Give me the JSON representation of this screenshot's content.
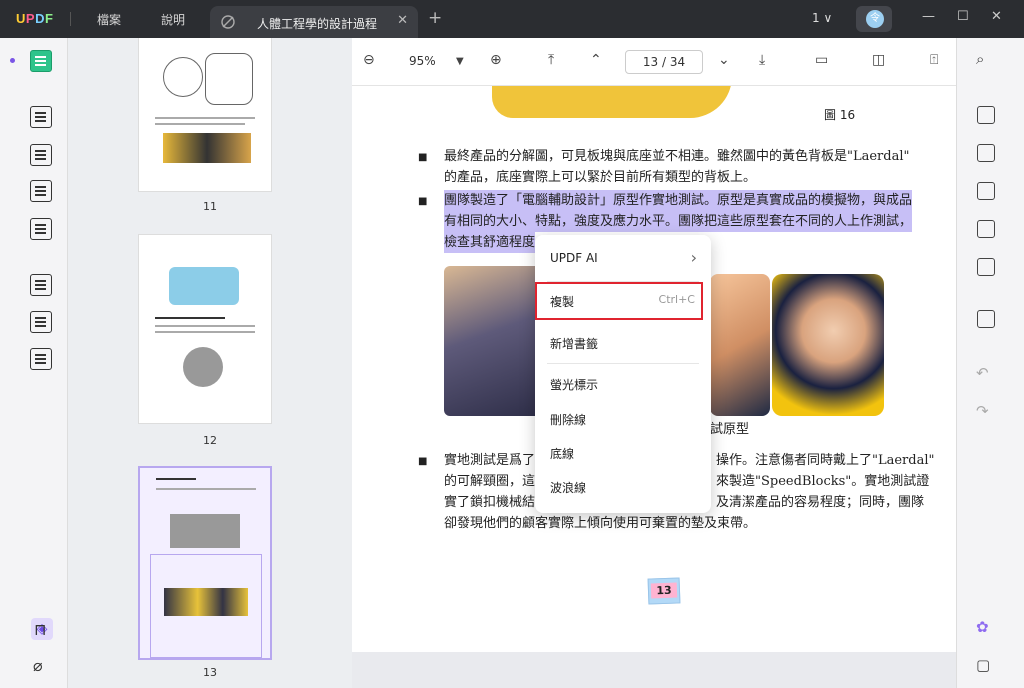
{
  "titlebar": {
    "logo": "UPDF",
    "menu": [
      "檔案",
      "說明"
    ],
    "tab_title": "人體工程學的設計過程",
    "tab_close": "✕",
    "tab_add": "+",
    "page_count": "1 ∨",
    "avatar_letter": "令",
    "min": "—",
    "max": "☐",
    "close": "✕"
  },
  "toolbar": {
    "zoom": "95%",
    "page_current": "13",
    "page_total": "34",
    "page_sep": "/"
  },
  "thumbnails": [
    {
      "label": "11"
    },
    {
      "label": "12"
    },
    {
      "label": "13"
    }
  ],
  "document": {
    "figure_caption": "圖 16",
    "paragraph1_line1": "最終產品的分解圖，可見板塊與底座並不相連。雖然圖中的黃色背板是\"Laerdal\"",
    "paragraph1_line2": "的產品，底座實際上可以緊於目前所有類型的背板上。",
    "paragraph2_line1": "團隊製造了「電腦輔助設計」原型作實地測試。原型是真實成品的模擬物，與成品",
    "paragraph2_line2": "有相同的大小、特點，強度及應力水平。團隊把這些原型套在不同的人上作測試，",
    "paragraph2_line3": "檢查其舒適程度",
    "image_caption": "試原型",
    "paragraph3_line1": "實地測試是爲了",
    "paragraph3_line1b": "操作。注意傷者同時戴上了\"Laerdal\"",
    "paragraph3_line2": "的可解頸圈，這",
    "paragraph3_line2b": "來製造\"SpeedBlocks\"。實地測試證",
    "paragraph3_line3": "實了鎖扣機械結",
    "paragraph3_line3b": "及清潔產品的容易程度；同時，團隊",
    "paragraph3_line4": "卻發現他們的顧客實際上傾向使用可棄置的墊及束帶。",
    "page_badge": "13"
  },
  "context_menu": {
    "items": [
      {
        "label": "UPDF AI",
        "shortcut": "",
        "submenu": "›"
      },
      {
        "label": "複製",
        "shortcut": "Ctrl+C"
      },
      {
        "label": "新增書籤",
        "shortcut": ""
      },
      {
        "label": "螢光標示",
        "shortcut": ""
      },
      {
        "label": "刪除線",
        "shortcut": ""
      },
      {
        "label": "底線",
        "shortcut": ""
      },
      {
        "label": "波浪線",
        "shortcut": ""
      }
    ],
    "highlight_color": "#e0242f"
  },
  "colors": {
    "accent": "#2ec48b",
    "selection": "#c7bff6",
    "layer_accent": "#6e4ce6"
  }
}
